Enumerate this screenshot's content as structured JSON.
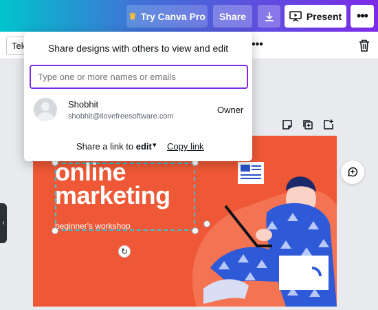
{
  "topbar": {
    "pro_label": "Try Canva Pro",
    "share_label": "Share",
    "present_label": "Present",
    "more_label": "•••",
    "accent_colors": [
      "#00c4cc",
      "#7d2ae8"
    ]
  },
  "toolbar": {
    "font_value": "Tele",
    "more_label": "•••"
  },
  "share_popover": {
    "title": "Share designs with others to view and edit",
    "input_placeholder": "Type one or more names or emails",
    "user": {
      "name": "Shobhit",
      "email": "shobhit@ilovefreesoftware.com",
      "role": "Owner"
    },
    "link_prefix": "Share a link to",
    "link_permission": "edit",
    "copy_link_label": "Copy link"
  },
  "design": {
    "heading_line1": "online",
    "heading_line2": "marketing",
    "subheading": "beginner's workshop",
    "background_color": "#ef5836"
  },
  "icons": [
    "crown-icon",
    "download-icon",
    "present-icon",
    "trash-icon",
    "note-icon",
    "duplicate-icon",
    "add-page-icon",
    "comment-icon",
    "rotate-icon",
    "chevron-down-icon",
    "collapse-icon"
  ]
}
